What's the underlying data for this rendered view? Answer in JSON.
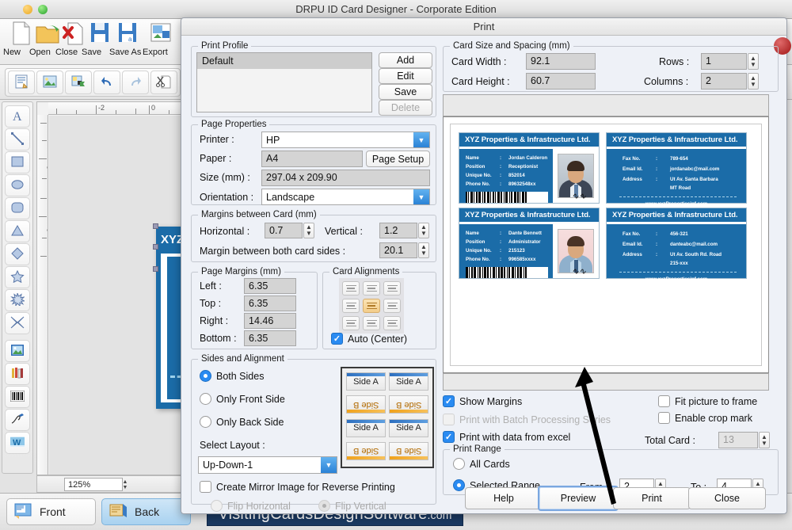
{
  "window": {
    "title": "DRPU ID Card Designer - Corporate Edition",
    "controls": {
      "yellow": "minimize",
      "green": "maximize"
    }
  },
  "toolbar": {
    "items": [
      {
        "label": "New",
        "icon": "new-document-icon"
      },
      {
        "label": "Open",
        "icon": "open-folder-icon"
      },
      {
        "label": "Close",
        "icon": "close-document-icon"
      },
      {
        "label": "Save",
        "icon": "save-floppy-icon"
      },
      {
        "label": "Save As",
        "icon": "save-as-floppy-icon"
      },
      {
        "label": "Export",
        "icon": "export-image-icon"
      }
    ],
    "second_row": [
      {
        "icon": "card-properties-icon"
      },
      {
        "icon": "background-image-icon"
      },
      {
        "icon": "image-export-icon"
      },
      {
        "icon": "undo-icon"
      },
      {
        "icon": "redo-icon"
      },
      {
        "icon": "cut-icon"
      }
    ]
  },
  "tool_palette": [
    {
      "icon": "text-tool-icon",
      "label": "Text"
    },
    {
      "icon": "line-tool-icon",
      "label": "Line"
    },
    {
      "icon": "rectangle-tool-icon",
      "label": "Rectangle"
    },
    {
      "icon": "ellipse-tool-icon",
      "label": "Ellipse"
    },
    {
      "icon": "rounded-rect-tool-icon",
      "label": "Rounded Rectangle"
    },
    {
      "icon": "triangle-tool-icon",
      "label": "Triangle"
    },
    {
      "icon": "diamond-tool-icon",
      "label": "Diamond"
    },
    {
      "icon": "star-tool-icon",
      "label": "Star"
    },
    {
      "icon": "burst-tool-icon",
      "label": "Burst"
    },
    {
      "icon": "four-point-star-tool-icon",
      "label": "Four Point Star"
    },
    {
      "icon": "picture-tool-icon",
      "label": "Picture"
    },
    {
      "icon": "library-tool-icon",
      "label": "Library"
    },
    {
      "icon": "barcode-tool-icon",
      "label": "Barcode"
    },
    {
      "icon": "signature-tool-icon",
      "label": "Signature"
    },
    {
      "icon": "watermark-tool-icon",
      "label": "Watermark"
    }
  ],
  "canvas": {
    "ruler_labels_h": [
      "-2",
      "0"
    ],
    "ruler_labels_v": [
      "-2",
      "0"
    ],
    "card_title": "XYZ",
    "zoom": "125%"
  },
  "bottom_tabs": [
    {
      "label": "Front",
      "icon": "front-side-icon",
      "active": false
    },
    {
      "label": "Back",
      "icon": "back-side-icon",
      "active": true
    }
  ],
  "watermark": {
    "name": "VisitingCardsDesignSoftware",
    "tld": ".com"
  },
  "dialog": {
    "title": "Print",
    "print_profile": {
      "legend": "Print Profile",
      "items": [
        "Default"
      ],
      "buttons": [
        {
          "label": "Add",
          "enabled": true
        },
        {
          "label": "Edit",
          "enabled": true
        },
        {
          "label": "Save",
          "enabled": true
        },
        {
          "label": "Delete",
          "enabled": false
        }
      ]
    },
    "page_properties": {
      "legend": "Page Properties",
      "printer_label": "Printer :",
      "printer_value": "HP",
      "paper_label": "Paper :",
      "paper_value": "A4",
      "page_setup_button": "Page Setup",
      "size_label": "Size (mm) :",
      "size_value": "297.04 x 209.90",
      "orientation_label": "Orientation :",
      "orientation_value": "Landscape"
    },
    "margins_between_card": {
      "legend": "Margins between Card (mm)",
      "horizontal_label": "Horizontal :",
      "horizontal_value": "0.7",
      "vertical_label": "Vertical :",
      "vertical_value": "1.2",
      "both_sides_label": "Margin between both card sides :",
      "both_sides_value": "20.1"
    },
    "page_margins": {
      "legend": "Page Margins (mm)",
      "left_label": "Left :",
      "left_value": "6.35",
      "top_label": "Top :",
      "top_value": "6.35",
      "right_label": "Right :",
      "right_value": "14.46",
      "bottom_label": "Bottom :",
      "bottom_value": "6.35"
    },
    "card_alignments": {
      "legend": "Card Alignments",
      "selected_index": 4,
      "auto_center_label": "Auto (Center)",
      "auto_center_checked": true
    },
    "sides_and_alignment": {
      "legend": "Sides and Alignment",
      "options": [
        {
          "label": "Both Sides",
          "selected": true
        },
        {
          "label": "Only Front Side",
          "selected": false
        },
        {
          "label": "Only Back Side",
          "selected": false
        }
      ],
      "select_layout_label": "Select Layout :",
      "select_layout_value": "Up-Down-1",
      "layout_preview_cells": [
        "Side A",
        "Side A",
        "Side B",
        "Side B",
        "Side A",
        "Side A",
        "Side B",
        "Side B"
      ],
      "mirror_label": "Create Mirror Image for Reverse Printing",
      "mirror_checked": false,
      "flip_horizontal_label": "Flip Horizontal",
      "flip_vertical_label": "Flip Vertical",
      "flip_selected": "Flip Vertical"
    },
    "card_size_spacing": {
      "legend": "Card Size and Spacing (mm)",
      "card_width_label": "Card Width :",
      "card_width_value": "92.1",
      "card_height_label": "Card Height :",
      "card_height_value": "60.7",
      "rows_label": "Rows :",
      "rows_value": "1",
      "columns_label": "Columns :",
      "columns_value": "2"
    },
    "options": {
      "show_margins": {
        "label": "Show Margins",
        "checked": true,
        "enabled": true
      },
      "batch_processing": {
        "label": "Print with Batch Processing Series",
        "checked": false,
        "enabled": false
      },
      "data_from_excel": {
        "label": "Print with data from excel",
        "checked": true,
        "enabled": true
      },
      "fit_picture": {
        "label": "Fit picture to frame",
        "checked": false,
        "enabled": true
      },
      "crop_mark": {
        "label": "Enable crop mark",
        "checked": false,
        "enabled": true
      },
      "total_card_label": "Total Card :",
      "total_card_value": "13"
    },
    "print_range": {
      "legend": "Print Range",
      "all_cards_label": "All Cards",
      "all_cards_selected": false,
      "selected_range_label": "Selected Range",
      "selected_range_selected": true,
      "from_label": "From :",
      "from_value": "2",
      "to_label": "To :",
      "to_value": "4"
    },
    "buttons": [
      {
        "label": "Help",
        "focused": false
      },
      {
        "label": "Preview",
        "focused": true
      },
      {
        "label": "Print",
        "focused": false
      },
      {
        "label": "Close",
        "focused": false
      }
    ]
  },
  "cards": [
    {
      "side": "front",
      "company": "XYZ Properties & Infrastructure Ltd.",
      "rows": [
        {
          "key": "Name",
          "value": "Jordan Calderon"
        },
        {
          "key": "Position",
          "value": "Receptionist"
        },
        {
          "key": "Unique No.",
          "value": "852014"
        },
        {
          "key": "Phone No.",
          "value": "89632548xx"
        }
      ]
    },
    {
      "side": "back",
      "company": "XYZ Properties & Infrastructure Ltd.",
      "rows": [
        {
          "key": "Fax No.",
          "value": "789-654"
        },
        {
          "key": "Email Id.",
          "value": "jordanabc@mail.com"
        },
        {
          "key": "Address",
          "value": "Ut Av. Santa Barbara"
        },
        {
          "key": "",
          "value": "MT Road"
        }
      ],
      "website": "www.xyzPropertiesinf.com"
    },
    {
      "side": "front",
      "company": "XYZ Properties & Infrastructure Ltd.",
      "rows": [
        {
          "key": "Name",
          "value": "Dante Bennett"
        },
        {
          "key": "Position",
          "value": "Administrator"
        },
        {
          "key": "Unique No.",
          "value": "215123"
        },
        {
          "key": "Phone No.",
          "value": "996585xxxx"
        }
      ]
    },
    {
      "side": "back",
      "company": "XYZ Properties & Infrastructure Ltd.",
      "rows": [
        {
          "key": "Fax No.",
          "value": "456-321"
        },
        {
          "key": "Email Id.",
          "value": "danteabc@mail.com"
        },
        {
          "key": "Address",
          "value": "Ut Av. South Rd. Road"
        },
        {
          "key": "",
          "value": "215-xxx"
        }
      ],
      "website": "www.xyzPropertiesinf.com"
    }
  ],
  "colors": {
    "card_blue": "#1b6ca8",
    "accent_blue": "#2a8bf2",
    "selection_orange": "#f3cd8a"
  }
}
